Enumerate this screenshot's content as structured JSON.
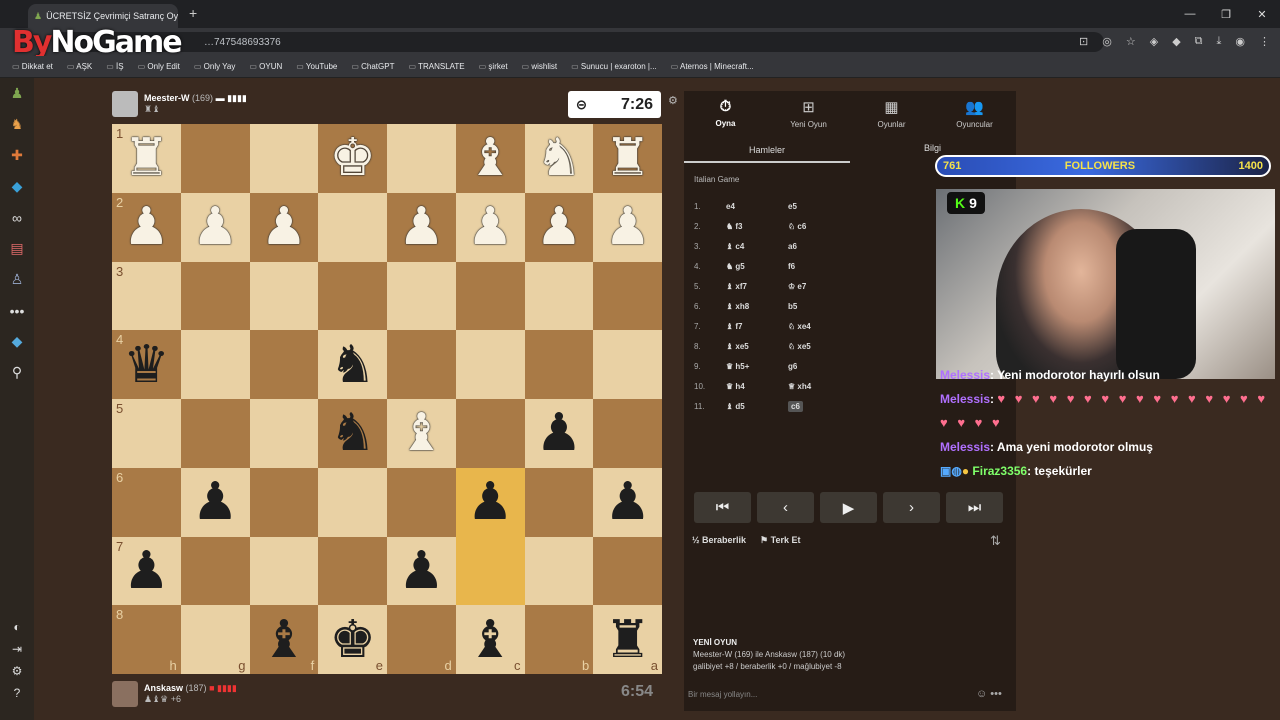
{
  "browser": {
    "tab_title": "ÜCRETSİZ Çevrimiçi Satranç Oy",
    "url": "...3475486933776",
    "url_text": "…747548693376",
    "watermark_by": "By",
    "watermark_rest": "NoGame",
    "bookmarks": [
      "Dikkat et",
      "AŞK",
      "İŞ",
      "Only Edit",
      "Only Yay",
      "OYUN",
      "YouTube",
      "ChatGPT",
      "TRANSLATE",
      "şirket",
      "wishlist",
      "Sunucu | exaroton |...",
      "Aternos | Minecraft..."
    ]
  },
  "players": {
    "top": {
      "name": "Meester-W",
      "rating": "(169)",
      "clock": "7:26",
      "material": "♜♝"
    },
    "bottom": {
      "name": "Anskasw",
      "rating": "(187)",
      "clock": "6:54",
      "material": "♟♝♛ +6"
    }
  },
  "board": {
    "rows": [
      [
        "wR",
        "",
        "",
        "wK",
        "",
        "wB",
        "wN",
        "wR"
      ],
      [
        "wP",
        "wP",
        "wP",
        "",
        "wP",
        "wP",
        "wP",
        "wP"
      ],
      [
        "",
        "",
        "",
        "",
        "",
        "",
        "",
        ""
      ],
      [
        "bQ",
        "",
        "",
        "bN",
        "",
        "",
        "",
        ""
      ],
      [
        "",
        "",
        "",
        "bN",
        "wB",
        "",
        "bP",
        ""
      ],
      [
        "",
        "bP",
        "",
        "",
        "",
        "bP",
        "",
        "bP"
      ],
      [
        "bP",
        "",
        "",
        "",
        "bP",
        "",
        "",
        ""
      ],
      [
        "",
        "",
        "bB",
        "bK",
        "",
        "bB",
        "",
        "bR"
      ]
    ],
    "ranks": [
      "1",
      "2",
      "3",
      "4",
      "5",
      "6",
      "7",
      "8"
    ],
    "files": [
      "h",
      "g",
      "f",
      "e",
      "d",
      "c",
      "b",
      "a"
    ],
    "highlight": [
      [
        5,
        5
      ],
      [
        6,
        5
      ]
    ]
  },
  "panel": {
    "tabs": [
      {
        "icon": "⏱",
        "label": "Oyna"
      },
      {
        "icon": "⊞",
        "label": "Yeni Oyun"
      },
      {
        "icon": "▦",
        "label": "Oyunlar"
      },
      {
        "icon": "👥",
        "label": "Oyuncular"
      }
    ],
    "subtab_moves": "Hamleler",
    "subtab_info": "Bilgi",
    "opening": "Italian Game",
    "moves": [
      {
        "n": "1.",
        "w": "e4",
        "b": "e5"
      },
      {
        "n": "2.",
        "w": "♞ f3",
        "b": "♘ c6"
      },
      {
        "n": "3.",
        "w": "♝ c4",
        "b": "a6"
      },
      {
        "n": "4.",
        "w": "♞ g5",
        "b": "f6"
      },
      {
        "n": "5.",
        "w": "♝ xf7",
        "b": "♔ e7"
      },
      {
        "n": "6.",
        "w": "♝ xh8",
        "b": "b5"
      },
      {
        "n": "7.",
        "w": "♝ f7",
        "b": "♘ xe4"
      },
      {
        "n": "8.",
        "w": "♝ xe5",
        "b": "♘ xe5"
      },
      {
        "n": "9.",
        "w": "♛ h5+",
        "b": "g6"
      },
      {
        "n": "10.",
        "w": "♛ h4",
        "b": "♕ xh4"
      },
      {
        "n": "11.",
        "w": "♝ d5",
        "b": "c6"
      }
    ],
    "draw_label": "Beraberlik",
    "resign_label": "Terk Et",
    "new_game_title": "YENİ OYUN",
    "new_game_line1": "Meester-W (169) ile Anskasw (187) (10 dk)",
    "new_game_line2": "galibiyet +8 / beraberlik +0 / mağlubiyet -8",
    "message_placeholder": "Bir mesaj yollayın..."
  },
  "stream": {
    "followers_current": "761",
    "followers_label": "FOLLOWERS",
    "followers_goal": "1400",
    "followers_progress": 0.54,
    "kick_count": "9",
    "chat": [
      {
        "user": "Melessis",
        "text": ": Yeni modorotor hayırlı olsun"
      },
      {
        "user": "Melessis",
        "text": ":",
        "emotes": "♥ ♥ ♥ ♥ ♥ ♥ ♥ ♥ ♥ ♥ ♥ ♥ ♥ ♥ ♥ ♥ ♥ ♥ ♥ ♥"
      },
      {
        "user": "Melessis",
        "text": ": Ama yeni modorotor olmuş"
      },
      {
        "user": "Firaz3356",
        "text": ": teşekürler"
      }
    ]
  },
  "colors": {
    "light_square": "#e9d1a4",
    "dark_square": "#a97a46",
    "highlight": "#e8b64c",
    "chess_green": "#7fa650"
  }
}
